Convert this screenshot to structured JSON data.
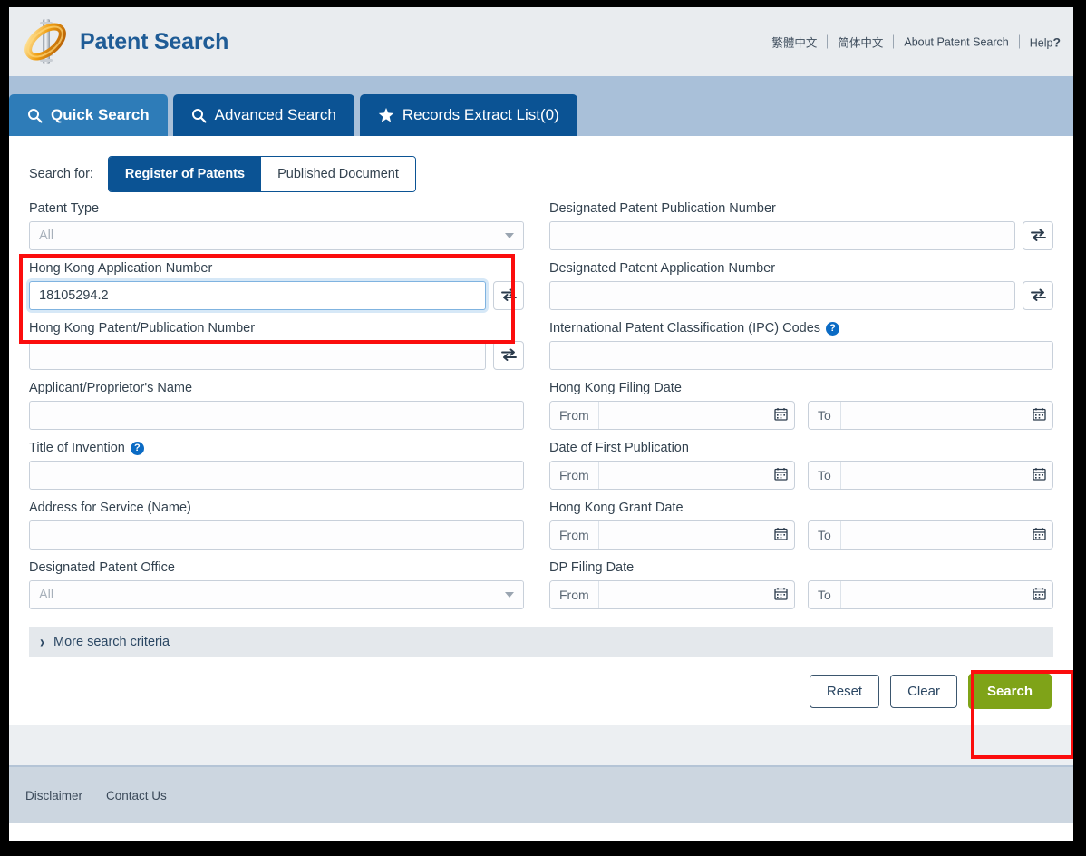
{
  "header": {
    "brand": "Patent Search",
    "logo_icon": "gold-ring-logo",
    "links": [
      {
        "label": "繁體中文",
        "name": "lang-traditional-chinese"
      },
      {
        "label": "简体中文",
        "name": "lang-simplified-chinese"
      },
      {
        "label": "About Patent Search",
        "name": "about-patent-search"
      },
      {
        "label": "Help",
        "name": "help",
        "suffix": "?"
      }
    ]
  },
  "tabs": [
    {
      "label": "Quick Search",
      "icon": "search-icon",
      "active": true
    },
    {
      "label": "Advanced Search",
      "icon": "search-icon",
      "active": false
    },
    {
      "label": "Records Extract List(0)",
      "icon": "star-icon",
      "active": false
    }
  ],
  "search_for": {
    "label": "Search for:",
    "options": [
      {
        "label": "Register of Patents",
        "active": true
      },
      {
        "label": "Published Document",
        "active": false
      }
    ]
  },
  "left_column": {
    "patent_type": {
      "label": "Patent Type",
      "value": "All"
    },
    "hk_application_number": {
      "label": "Hong Kong Application Number",
      "value": "18105294.2",
      "placeholder": "",
      "swap_icon": "swap-arrows-icon"
    },
    "hk_patent_publication_number": {
      "label": "Hong Kong Patent/Publication Number",
      "value": "",
      "placeholder": "",
      "swap_icon": "swap-arrows-icon"
    },
    "applicant_name": {
      "label": "Applicant/Proprietor's Name",
      "value": "",
      "placeholder": ""
    },
    "title_of_invention": {
      "label": "Title of Invention",
      "value": "",
      "placeholder": "",
      "help": "?"
    },
    "address_for_service": {
      "label": "Address for Service (Name)",
      "value": "",
      "placeholder": ""
    },
    "designated_patent_office": {
      "label": "Designated Patent Office",
      "value": "All"
    }
  },
  "right_column": {
    "dp_publication_number": {
      "label": "Designated Patent Publication Number",
      "value": "",
      "placeholder": "",
      "swap_icon": "swap-arrows-icon"
    },
    "dp_application_number": {
      "label": "Designated Patent Application Number",
      "value": "",
      "placeholder": "",
      "swap_icon": "swap-arrows-icon"
    },
    "ipc_codes": {
      "label": "International Patent Classification (IPC) Codes",
      "value": "",
      "placeholder": "",
      "help": "?"
    },
    "dates": [
      {
        "label": "Hong Kong Filing Date",
        "from_prefix": "From",
        "from_value": "",
        "from_placeholder": "",
        "to_prefix": "To",
        "to_value": "",
        "to_placeholder": "",
        "calendar_icon": "calendar-icon"
      },
      {
        "label": "Date of First Publication",
        "from_prefix": "From",
        "from_value": "",
        "from_placeholder": "",
        "to_prefix": "To",
        "to_value": "",
        "to_placeholder": "",
        "calendar_icon": "calendar-icon"
      },
      {
        "label": "Hong Kong Grant Date",
        "from_prefix": "From",
        "from_value": "",
        "from_placeholder": "",
        "to_prefix": "To",
        "to_value": "",
        "to_placeholder": "",
        "calendar_icon": "calendar-icon"
      },
      {
        "label": "DP Filing Date",
        "from_prefix": "From",
        "from_value": "",
        "from_placeholder": "",
        "to_prefix": "To",
        "to_value": "",
        "to_placeholder": "",
        "calendar_icon": "calendar-icon"
      }
    ]
  },
  "more_criteria": {
    "label": "More search criteria",
    "icon": "chevron-right-icon"
  },
  "actions": {
    "reset": "Reset",
    "clear": "Clear",
    "search": "Search"
  },
  "footer": {
    "links": [
      {
        "label": "Disclaimer"
      },
      {
        "label": "Contact Us"
      }
    ]
  },
  "colors": {
    "brand_blue": "#1f5c96",
    "tab_active": "#2e7cb8",
    "tab_inactive": "#0b5394",
    "tabbar_bg": "#a9c0d9",
    "search_green": "#7fa318",
    "highlight_red": "#fb0d0d",
    "footer_bg": "#ccd6e0"
  },
  "annotations": [
    {
      "name": "hk-application-number-highlight"
    },
    {
      "name": "search-button-highlight"
    }
  ]
}
